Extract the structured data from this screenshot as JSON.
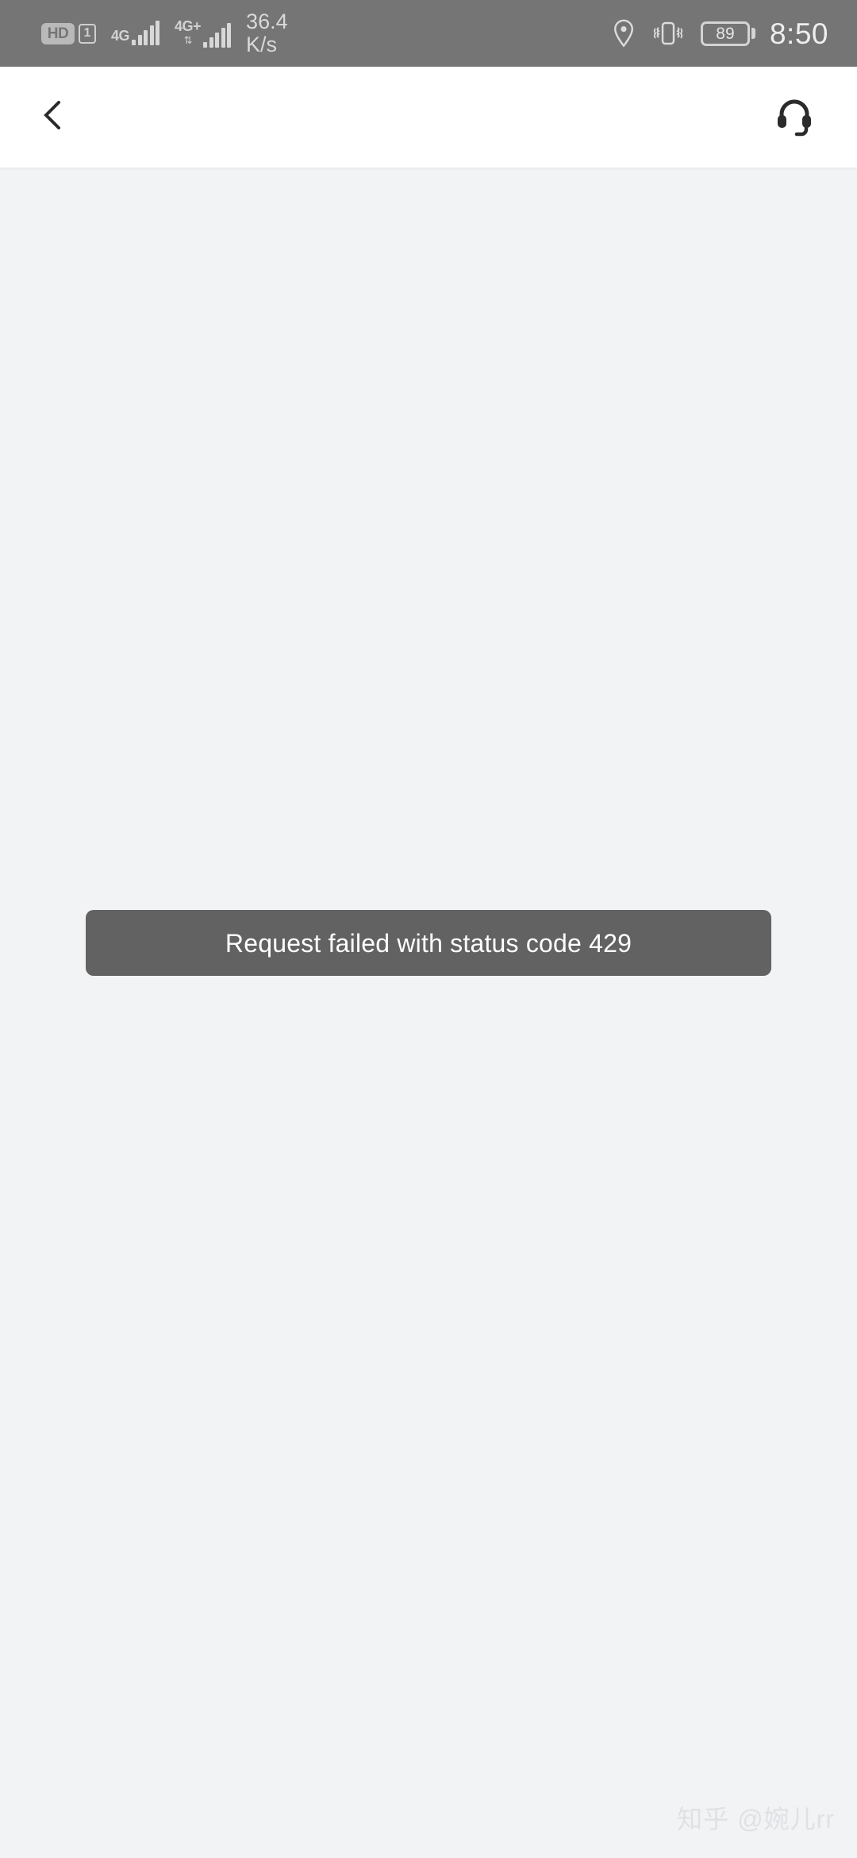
{
  "status_bar": {
    "background_color": "#757575",
    "hd_label": "HD",
    "sim_label": "1",
    "network_primary": "4G",
    "network_secondary": "4G+",
    "data_arrows": "⇅",
    "speed_value": "36.4",
    "speed_unit": "K/s",
    "battery_level": "89",
    "clock": "8:50",
    "icons": [
      "hd-icon",
      "sim-icon",
      "signal-bars-icon",
      "location-pin-icon",
      "vibrate-icon",
      "battery-icon"
    ]
  },
  "app_bar": {
    "background_color": "#ffffff",
    "back_icon": "chevron-left-icon",
    "support_icon": "headset-icon",
    "title": ""
  },
  "main": {
    "background_color": "#f2f3f5",
    "toast": {
      "message": "Request failed with status code 429",
      "background_color": "#626262",
      "text_color": "#ffffff"
    }
  },
  "watermark": {
    "text": "知乎 @婉儿rr",
    "color": "#dfe1e4"
  }
}
